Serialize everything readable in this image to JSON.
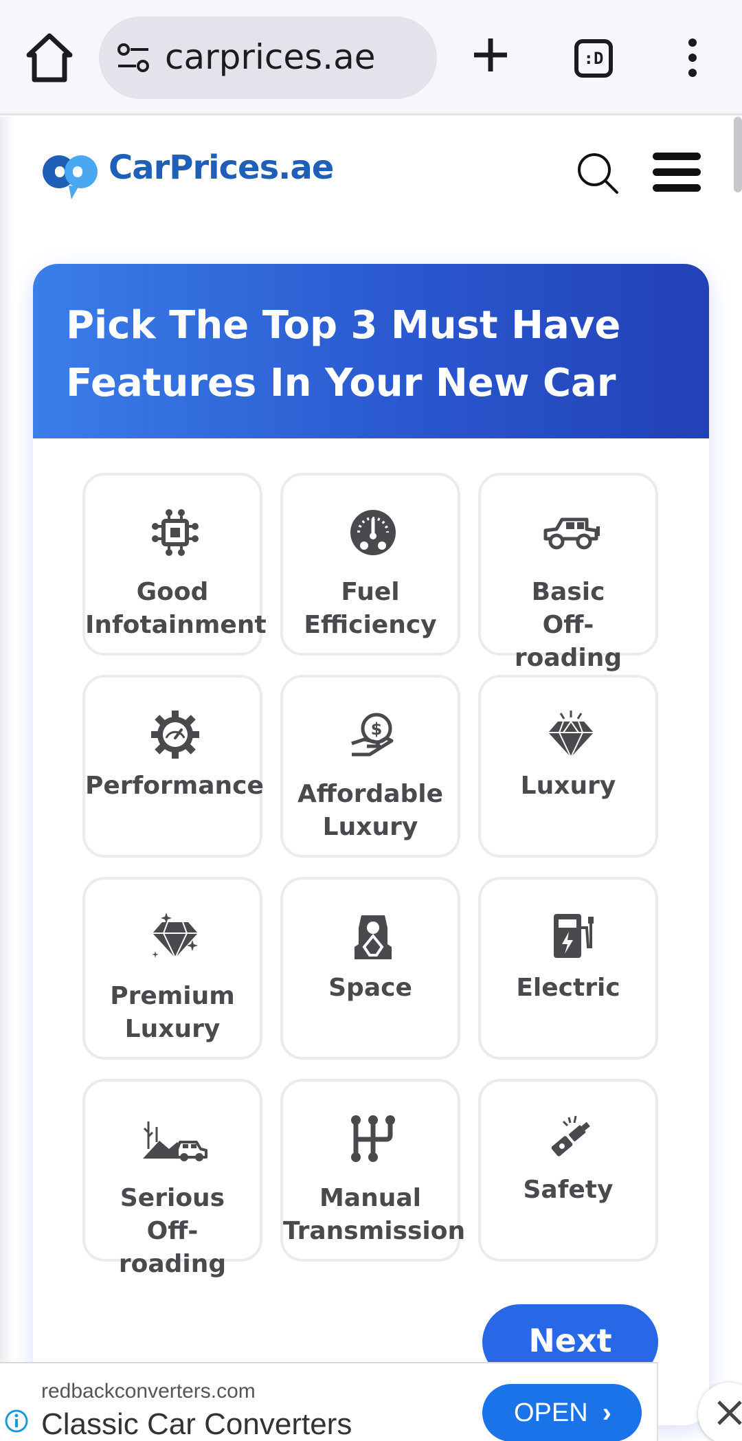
{
  "browser": {
    "url": "carprices.ae",
    "tab_switcher_label": ":D"
  },
  "site": {
    "logo_text": "CarPrices.ae"
  },
  "quiz": {
    "title": "Pick The Top 3 Must Have Features In Your New Car",
    "options": [
      {
        "label": "Good\nInfotainment",
        "icon": "chip-icon"
      },
      {
        "label": "Fuel\nEfficiency",
        "icon": "fuel-gauge-icon"
      },
      {
        "label": "Basic\nOff-\nroading",
        "icon": "jeep-icon"
      },
      {
        "label": "Performance",
        "icon": "gear-speedometer-icon"
      },
      {
        "label": "Affordable\nLuxury",
        "icon": "hand-money-icon"
      },
      {
        "label": "Luxury",
        "icon": "diamond-icon"
      },
      {
        "label": "Premium\nLuxury",
        "icon": "sparkle-diamond-icon"
      },
      {
        "label": "Space",
        "icon": "car-seat-icon"
      },
      {
        "label": "Electric",
        "icon": "charging-station-icon"
      },
      {
        "label": "Serious\nOff-\nroading",
        "icon": "desert-car-icon"
      },
      {
        "label": "Manual\nTransmission",
        "icon": "gear-shift-icon"
      },
      {
        "label": "Safety",
        "icon": "seatbelt-icon"
      }
    ],
    "next_label": "Next"
  },
  "ad": {
    "domain": "redbackconverters.com",
    "headline": "Classic Car Converters",
    "cta": "OPEN"
  },
  "colors": {
    "brand_blue": "#1f5fb8",
    "header_gradient_start": "#3a7ee8",
    "header_gradient_end": "#2341b6",
    "next_button": "#2867e6",
    "icon_gray": "#4a4a4e"
  }
}
